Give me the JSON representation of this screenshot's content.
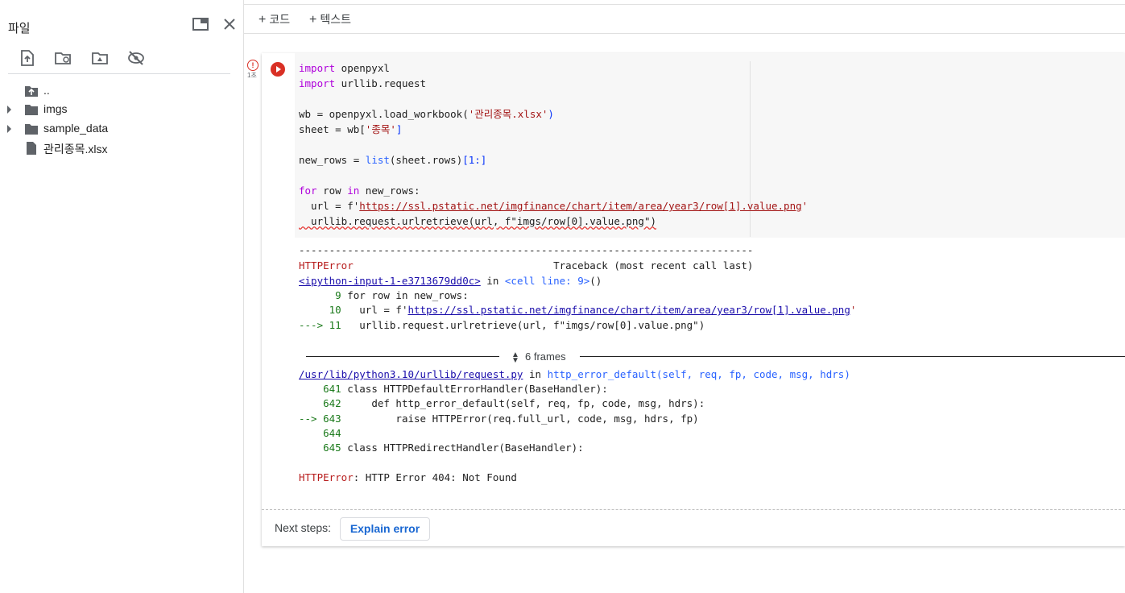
{
  "sidebar": {
    "title": "파일",
    "tree": [
      {
        "label": ".."
      },
      {
        "label": "imgs"
      },
      {
        "label": "sample_data"
      },
      {
        "label": "관리종목.xlsx"
      }
    ]
  },
  "toolbar": {
    "add_code": "코드",
    "add_text": "텍스트"
  },
  "cell": {
    "status_time": "1초",
    "code": {
      "l1_kw": "import",
      "l1_rest": " openpyxl",
      "l2_kw": "import",
      "l2_rest": " urllib.request",
      "l3_a": "wb = openpyxl.load_workbook(",
      "l3_str": "'관리종목.xlsx'",
      "l3_b": ")",
      "l4_a": "sheet = wb[",
      "l4_str": "'종목'",
      "l4_b": "]",
      "l5_a": "new_rows = ",
      "l5_fn": "list",
      "l5_b": "(sheet.rows)",
      "l5_c": "[1:]",
      "l6_kw": "for",
      "l6_a": " row ",
      "l6_kw2": "in",
      "l6_b": " new_rows:",
      "l7_a": "  url = f'",
      "l7_url": "https://ssl.pstatic.net/imgfinance/chart/item/area/year3/row[1].value.png",
      "l7_b": "'",
      "l8": "  urllib.request.urlretrieve(url, f\"imgs/row[0].value.png\")"
    },
    "output": {
      "sep": "---------------------------------------------------------------------------",
      "err_name": "HTTPError",
      "traceback": "                                 Traceback (most recent call last)",
      "input_link": "<ipython-input-1-e3713679dd0c>",
      "in_word": " in ",
      "cell_line": "<cell line: 9>",
      "paren": "()",
      "t1_num": "      9",
      "t1_text": " for row in new_rows:",
      "t2_num": "     10",
      "t2_a": "   url = f'",
      "t2_url": "https://ssl.pstatic.net/imgfinance/chart/item/area/year3/row[1].value.png",
      "t2_b": "'",
      "t3_num": "---> 11",
      "t3_text": "   urllib.request.urlretrieve(url, f\"imgs/row[0].value.png\")",
      "frames": "6 frames",
      "lib_path": "/usr/lib/python3.10/urllib/request.py",
      "lib_in": " in ",
      "lib_func": "http_error_default",
      "lib_args": "(self, req, fp, code, msg, hdrs)",
      "r1_num": "    641",
      "r1_text": " class HTTPDefaultErrorHandler(BaseHandler):",
      "r2_num": "    642",
      "r2_text": "     def http_error_default(self, req, fp, code, msg, hdrs):",
      "r3_num": "--> 643",
      "r3_text": "         raise HTTPError(req.full_url, code, msg, hdrs, fp)",
      "r4_num": "    644",
      "r5_num": "    645",
      "r5_text": " class HTTPRedirectHandler(BaseHandler):",
      "final_name": "HTTPError",
      "final_msg": ": HTTP Error 404: Not Found"
    },
    "next_steps_label": "Next steps:",
    "explain_button": "Explain error"
  }
}
